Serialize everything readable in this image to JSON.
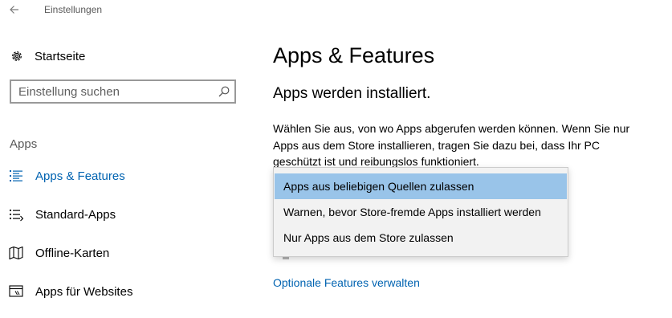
{
  "window": {
    "title": "Einstellungen",
    "back_icon": "arrow-left-icon"
  },
  "sidebar": {
    "home": {
      "label": "Startseite",
      "icon": "gear-icon"
    },
    "search": {
      "placeholder": "Einstellung suchen",
      "value": "",
      "icon": "search-icon"
    },
    "section_header": "Apps",
    "items": [
      {
        "label": "Apps & Features",
        "icon": "list-icon",
        "active": true
      },
      {
        "label": "Standard-Apps",
        "icon": "default-apps-icon",
        "active": false
      },
      {
        "label": "Offline-Karten",
        "icon": "map-icon",
        "active": false
      },
      {
        "label": "Apps für Websites",
        "icon": "website-apps-icon",
        "active": false
      }
    ]
  },
  "main": {
    "title": "Apps & Features",
    "subheading": "Apps werden installiert.",
    "description": "Wählen Sie aus, von wo Apps abgerufen werden können. Wenn Sie nur Apps aus dem Store installieren, tragen Sie dazu bei, dass Ihr PC geschützt ist und reibungslos funktioniert.",
    "dropdown": {
      "selected_index": 0,
      "options": [
        "Apps aus beliebigen Quellen zulassen",
        "Warnen, bevor Store-fremde Apps installiert werden",
        "Nur Apps aus dem Store zulassen"
      ]
    },
    "link": "Optionale Features verwalten"
  },
  "colors": {
    "accent": "#0063b1",
    "selection": "#99c4e9",
    "popup_background": "#f2f2f2",
    "secondary_text": "#595959"
  }
}
